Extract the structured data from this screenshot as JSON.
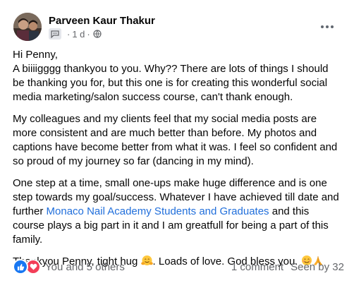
{
  "post": {
    "author": "Parveen Kaur Thakur",
    "time": "1 d",
    "paragraphs": {
      "p1_line1": "Hi Penny,",
      "p1_line2": "A biiiigggg thankyou to you. Why?? There are lots of things I should be thanking you for, but this one is for creating this wonderful social media marketing/salon success course, can't thank enough.",
      "p2": "My colleagues and my clients feel that my social media posts are more consistent and are much better than before. My photos and captions have become better from what it was. I feel so confident and so proud of my journey so far (dancing in my mind).",
      "p3_before": "One step at a time, small one-ups make huge difference and is one step towards my goal/success. Whatever I have achieved till date and further ",
      "p3_link": "Monaco Nail Academy Students and Graduates",
      "p3_after": "  and this course plays a big part in it and I am greatfull for being a part of this family.",
      "p4_before": "Thankyou Penny, tight hug ",
      "p4_mid": ". Loads of love. God bless you. "
    }
  },
  "footer": {
    "reactions_text": "You and 5 others",
    "comments": "1 comment",
    "seen": "Seen by 32"
  },
  "icons": {
    "avatar": "avatar-photo",
    "messenger": "messenger-icon",
    "globe": "globe-icon",
    "more": "more-options-icon",
    "like": "like-icon",
    "love": "love-icon",
    "hug_emoji": "hugging-face-emoji",
    "blush_emoji": "smiling-face-emoji",
    "pray_emoji": "folded-hands-emoji"
  },
  "colors": {
    "link": "#216fdb",
    "secondary_text": "#65676b",
    "like_blue": "#1877f2",
    "love_red": "#f33e58"
  }
}
